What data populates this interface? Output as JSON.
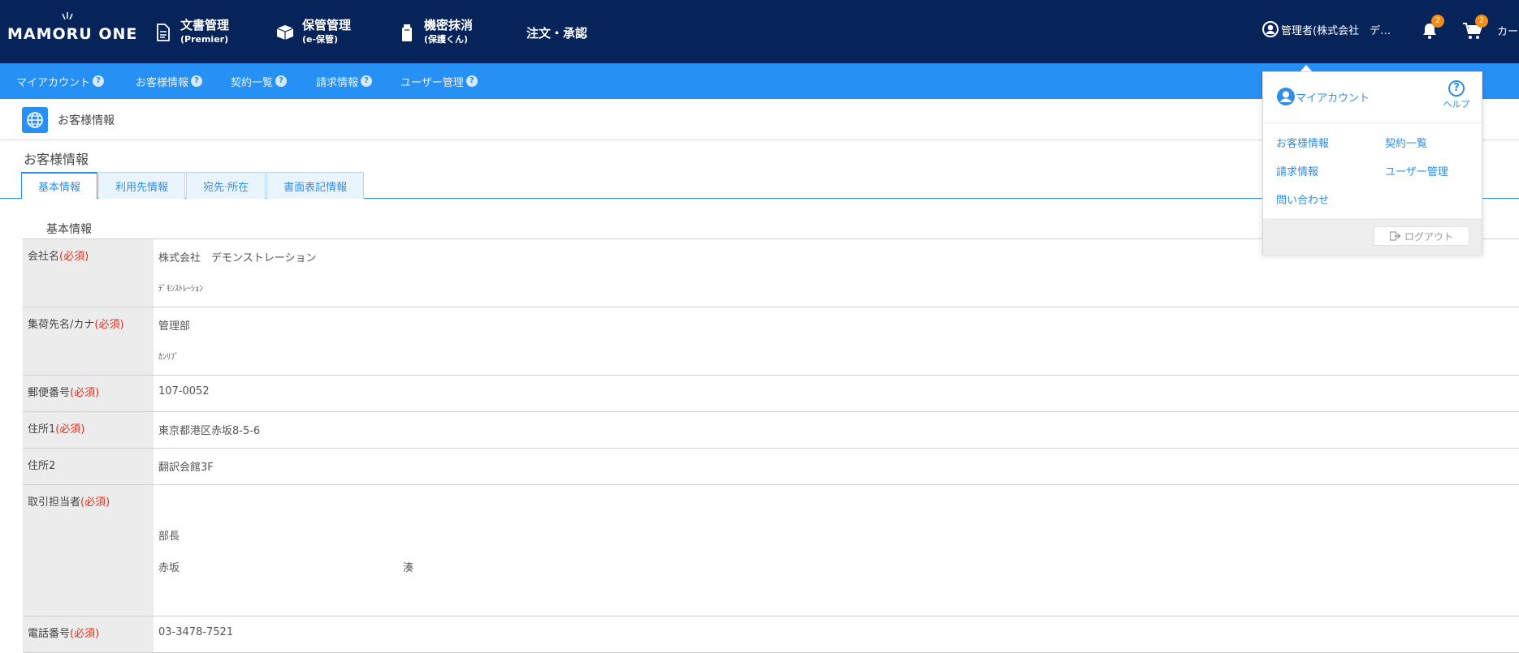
{
  "header": {
    "logo": "MAMORU ONE",
    "nav": [
      {
        "title": "文書管理",
        "sub": "(Premier)",
        "icon": "document-icon"
      },
      {
        "title": "保管管理",
        "sub": "(e-保管)",
        "icon": "box-icon"
      },
      {
        "title": "機密抹消",
        "sub": "(保護くん)",
        "icon": "shred-bin-icon"
      },
      {
        "title": "注文・承認"
      }
    ],
    "user_label": "管理者(株式会社　デ…",
    "notification_count": "2",
    "cart_count": "2",
    "cart_label": "カー"
  },
  "subnav": [
    {
      "label": "マイアカウント"
    },
    {
      "label": "お客様情報"
    },
    {
      "label": "契約一覧"
    },
    {
      "label": "請求情報"
    },
    {
      "label": "ユーザー管理"
    }
  ],
  "breadcrumb": {
    "current": "お客様情報"
  },
  "page": {
    "title": "お客様情報",
    "tabs": [
      "基本情報",
      "利用先情報",
      "宛先·所在",
      "書面表記情報"
    ],
    "section_title": "基本情報"
  },
  "required_mark": "(必須)",
  "form": {
    "company_label": "会社名",
    "company_name": "株式会社　デモンストレーション",
    "company_kana": "ﾃﾞﾓﾝｽﾄﾚｰｼｮﾝ",
    "pickup_label": "集荷先名/カナ",
    "pickup_name": "管理部",
    "pickup_kana": "ｶﾝﾘﾌﾞ",
    "zip_label": "郵便番号",
    "zip": "107-0052",
    "addr1_label": "住所1",
    "addr1": "東京都港区赤坂8-5-6",
    "addr2_label": "住所2",
    "addr2": "翻訳会館3F",
    "contact_label": "取引担当者",
    "contact_title": "部長",
    "contact_last": "赤坂",
    "contact_first": "湊",
    "phone_label": "電話番号",
    "phone": "03-3478-7521"
  },
  "dropdown": {
    "account_label": "マイアカウント",
    "help_label": "ヘルプ",
    "links": [
      "お客様情報",
      "契約一覧",
      "請求情報",
      "ユーザー管理",
      "問い合わせ"
    ],
    "logout_label": "ログアウト"
  },
  "colors": {
    "header_bg": "#06245a",
    "subnav_bg": "#2790f4",
    "accent": "#2f8ee8",
    "badge": "#f08c1c",
    "required": "#e0301e"
  }
}
